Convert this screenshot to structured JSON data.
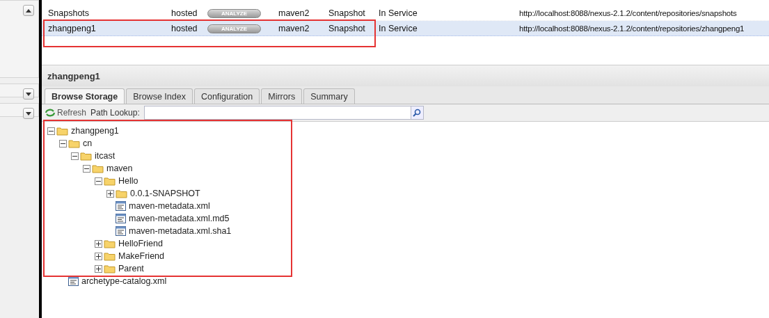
{
  "sidebar": {
    "panels": [
      {
        "expanded": true
      },
      {
        "expanded": false
      },
      {
        "expanded": false
      }
    ]
  },
  "repositories": {
    "rows": [
      {
        "name": "Snapshots",
        "type": "hosted",
        "analyze": "ANALYZE",
        "format": "maven2",
        "policy": "Snapshot",
        "status": "In Service",
        "url": "http://localhost:8088/nexus-2.1.2/content/repositories/snapshots",
        "selected": false
      },
      {
        "name": "zhangpeng1",
        "type": "hosted",
        "analyze": "ANALYZE",
        "format": "maven2",
        "policy": "Snapshot",
        "status": "In Service",
        "url": "http://localhost:8088/nexus-2.1.2/content/repositories/zhangpeng1",
        "selected": true
      }
    ]
  },
  "detail": {
    "title": "zhangpeng1",
    "tabs": [
      {
        "label": "Browse Storage",
        "selected": true
      },
      {
        "label": "Browse Index",
        "selected": false
      },
      {
        "label": "Configuration",
        "selected": false
      },
      {
        "label": "Mirrors",
        "selected": false
      },
      {
        "label": "Summary",
        "selected": false
      }
    ],
    "toolbar": {
      "refresh": "Refresh",
      "path_lookup_label": "Path Lookup:"
    },
    "tree": [
      {
        "kind": "folder",
        "label": "zhangpeng1",
        "expanded": true,
        "children": [
          {
            "kind": "folder",
            "label": "cn",
            "expanded": true,
            "children": [
              {
                "kind": "folder",
                "label": "itcast",
                "expanded": true,
                "children": [
                  {
                    "kind": "folder",
                    "label": "maven",
                    "expanded": true,
                    "children": [
                      {
                        "kind": "folder",
                        "label": "Hello",
                        "expanded": true,
                        "children": [
                          {
                            "kind": "folder",
                            "label": "0.0.1-SNAPSHOT",
                            "expanded": false
                          },
                          {
                            "kind": "file",
                            "label": "maven-metadata.xml"
                          },
                          {
                            "kind": "file",
                            "label": "maven-metadata.xml.md5"
                          },
                          {
                            "kind": "file",
                            "label": "maven-metadata.xml.sha1"
                          }
                        ]
                      },
                      {
                        "kind": "folder",
                        "label": "HelloFriend",
                        "expanded": false
                      },
                      {
                        "kind": "folder",
                        "label": "MakeFriend",
                        "expanded": false
                      },
                      {
                        "kind": "folder",
                        "label": "Parent",
                        "expanded": false
                      }
                    ]
                  }
                ]
              }
            ]
          },
          {
            "kind": "file",
            "label": "archetype-catalog.xml"
          }
        ]
      }
    ]
  }
}
